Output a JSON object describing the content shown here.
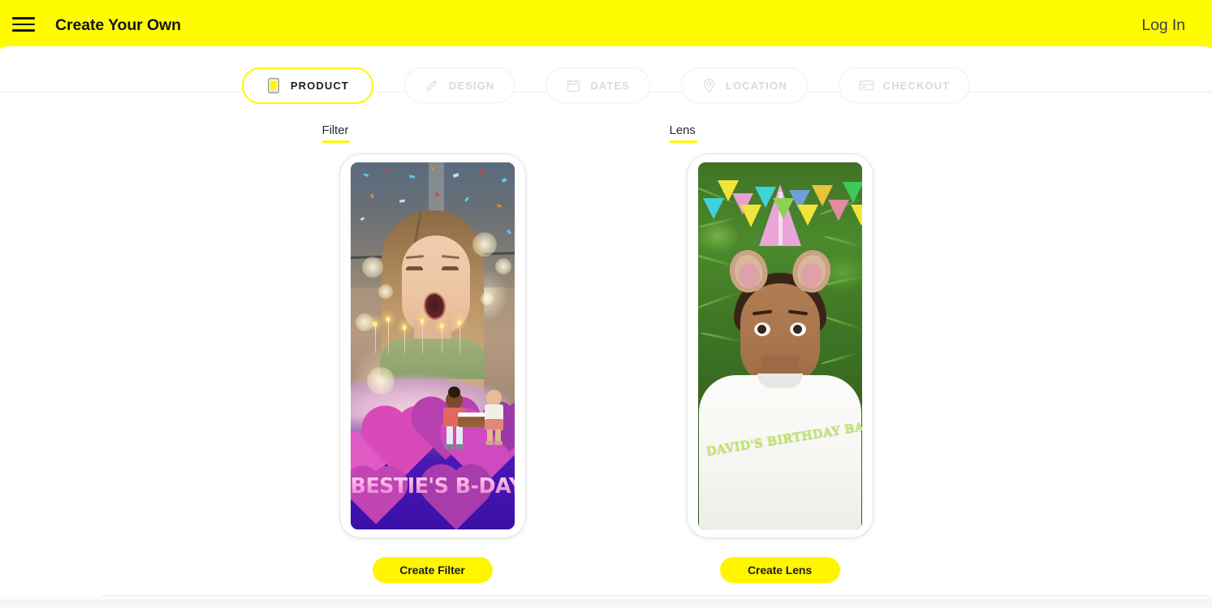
{
  "header": {
    "menu_icon": "hamburger-menu-icon",
    "title": "Create Your Own",
    "login_label": "Log In",
    "background_color": "#fffc00",
    "text_color": "#15161a"
  },
  "stepper": {
    "accent_color": "#fff500",
    "inactive_color": "#d7dade",
    "steps": [
      {
        "label": "PRODUCT",
        "icon": "phone-icon",
        "active": true
      },
      {
        "label": "DESIGN",
        "icon": "pencil-icon",
        "active": false
      },
      {
        "label": "DATES",
        "icon": "calendar-icon",
        "active": false
      },
      {
        "label": "LOCATION",
        "icon": "map-pin-icon",
        "active": false
      },
      {
        "label": "CHECKOUT",
        "icon": "credit-card-icon",
        "active": false
      }
    ]
  },
  "products": {
    "filter": {
      "section_title": "Filter",
      "preview_caption": "BESTIE'S B-DAY",
      "preview_description": "Birthday filter preview: woman blowing out candles with confetti and hearts overlay",
      "cta_label": "Create Filter"
    },
    "lens": {
      "section_title": "Lens",
      "preview_caption": "DAVID'S BIRTHDAY BASH",
      "preview_description": "Birthday lens preview: party hat and bunting AR lens on a surprised face",
      "cta_label": "Create Lens"
    }
  },
  "theme": {
    "brand_yellow": "#fff500",
    "header_yellow": "#fffc00",
    "ink": "#1d1e22",
    "border_grey": "#eceef1"
  }
}
